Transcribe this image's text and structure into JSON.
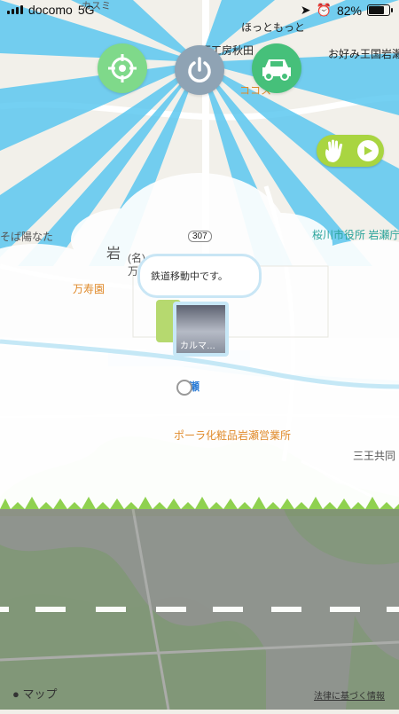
{
  "status_bar": {
    "carrier": "docomo",
    "network": "5G",
    "battery": "82%",
    "battery_level": 0.82
  },
  "map": {
    "labels": [
      {
        "key": "hotto_motto",
        "text": "ほっともっと"
      },
      {
        "key": "okonomi",
        "text": "お好み王国岩瀬"
      },
      {
        "key": "koubou",
        "text": "万工房秋田"
      },
      {
        "key": "cocos",
        "text": "ココス"
      },
      {
        "key": "sakuragawa",
        "text": "桜川市役所 岩瀬庁"
      },
      {
        "key": "soba",
        "text": "そば陽なた"
      },
      {
        "key": "iwa",
        "text": "岩"
      },
      {
        "key": "maru",
        "text": "(名)"
      },
      {
        "key": "man",
        "text": "万"
      },
      {
        "key": "manjuen",
        "text": "万寿園"
      },
      {
        "key": "route",
        "text": "307"
      },
      {
        "key": "station",
        "text": "瀬"
      },
      {
        "key": "pola",
        "text": "ポーラ化粧品岩瀬営業所"
      },
      {
        "key": "sannou",
        "text": "三王共同"
      },
      {
        "key": "top_cut",
        "text": "カスミ"
      }
    ]
  },
  "bubble": {
    "text": "鉄道移動中です。"
  },
  "thumbnail": {
    "caption": "カルマ…"
  },
  "buttons": {
    "gps": {
      "icon": "crosshair-icon"
    },
    "power": {
      "icon": "power-icon"
    },
    "car": {
      "icon": "car-icon"
    },
    "hand_play": {
      "icons": [
        "hand-icon",
        "play-icon"
      ]
    }
  },
  "footer": {
    "maps_label": "マップ",
    "legal_link": "法律に基づく情報"
  },
  "colors": {
    "sky": "#5cc8f0",
    "grass": "#8fd14f",
    "road": "#8a8d8a",
    "accent_green": "#a9d541"
  }
}
